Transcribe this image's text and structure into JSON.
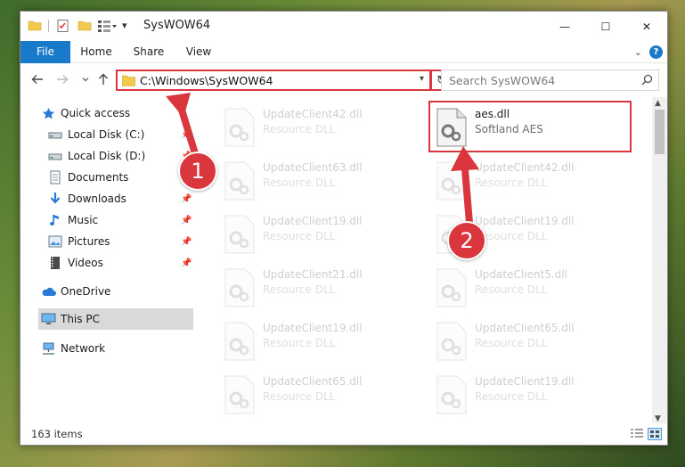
{
  "window": {
    "title": "SysWOW64",
    "controls": {
      "minimize": "—",
      "maximize": "☐",
      "close": "✕"
    }
  },
  "ribbon": {
    "tabs": [
      "File",
      "Home",
      "Share",
      "View"
    ],
    "help": "?"
  },
  "address_bar": {
    "path": "C:\\Windows\\SysWOW64",
    "refresh_icon": "refresh-icon"
  },
  "search": {
    "placeholder": "Search SysWOW64"
  },
  "sidebar": {
    "items": [
      {
        "label": "Quick access",
        "icon": "star-icon"
      },
      {
        "label": "Local Disk (C:)",
        "icon": "drive-icon"
      },
      {
        "label": "Local Disk (D:)",
        "icon": "drive-icon"
      },
      {
        "label": "Documents",
        "icon": "documents-icon"
      },
      {
        "label": "Downloads",
        "icon": "download-icon"
      },
      {
        "label": "Music",
        "icon": "music-icon"
      },
      {
        "label": "Pictures",
        "icon": "pictures-icon"
      },
      {
        "label": "Videos",
        "icon": "videos-icon"
      },
      {
        "label": "OneDrive",
        "icon": "cloud-icon"
      },
      {
        "label": "This PC",
        "icon": "computer-icon"
      },
      {
        "label": "Network",
        "icon": "network-icon"
      }
    ]
  },
  "files": {
    "left_column": [
      {
        "name": "UpdateClient42.dll",
        "desc": "Resource DLL"
      },
      {
        "name": "UpdateClient63.dll",
        "desc": "Resource DLL"
      },
      {
        "name": "UpdateClient19.dll",
        "desc": "Resource DLL"
      },
      {
        "name": "UpdateClient21.dll",
        "desc": "Resource DLL"
      },
      {
        "name": "UpdateClient19.dll",
        "desc": "Resource DLL"
      },
      {
        "name": "UpdateClient65.dll",
        "desc": "Resource DLL"
      }
    ],
    "right_column": [
      {
        "name": "aes.dll",
        "desc": "Softland AES"
      },
      {
        "name": "UpdateClient42.dll",
        "desc": "Resource DLL"
      },
      {
        "name": "UpdateClient19.dll",
        "desc": "Resource DLL"
      },
      {
        "name": "UpdateClient5.dll",
        "desc": "Resource DLL"
      },
      {
        "name": "UpdateClient65.dll",
        "desc": "Resource DLL"
      },
      {
        "name": "UpdateClient19.dll",
        "desc": "Resource DLL"
      }
    ]
  },
  "status": {
    "item_count": "163 items"
  },
  "annotations": {
    "step1": "1",
    "step2": "2",
    "highlight_color": "#d9363e"
  },
  "colors": {
    "accent": "#1979ca",
    "selection": "#cce8ff"
  }
}
